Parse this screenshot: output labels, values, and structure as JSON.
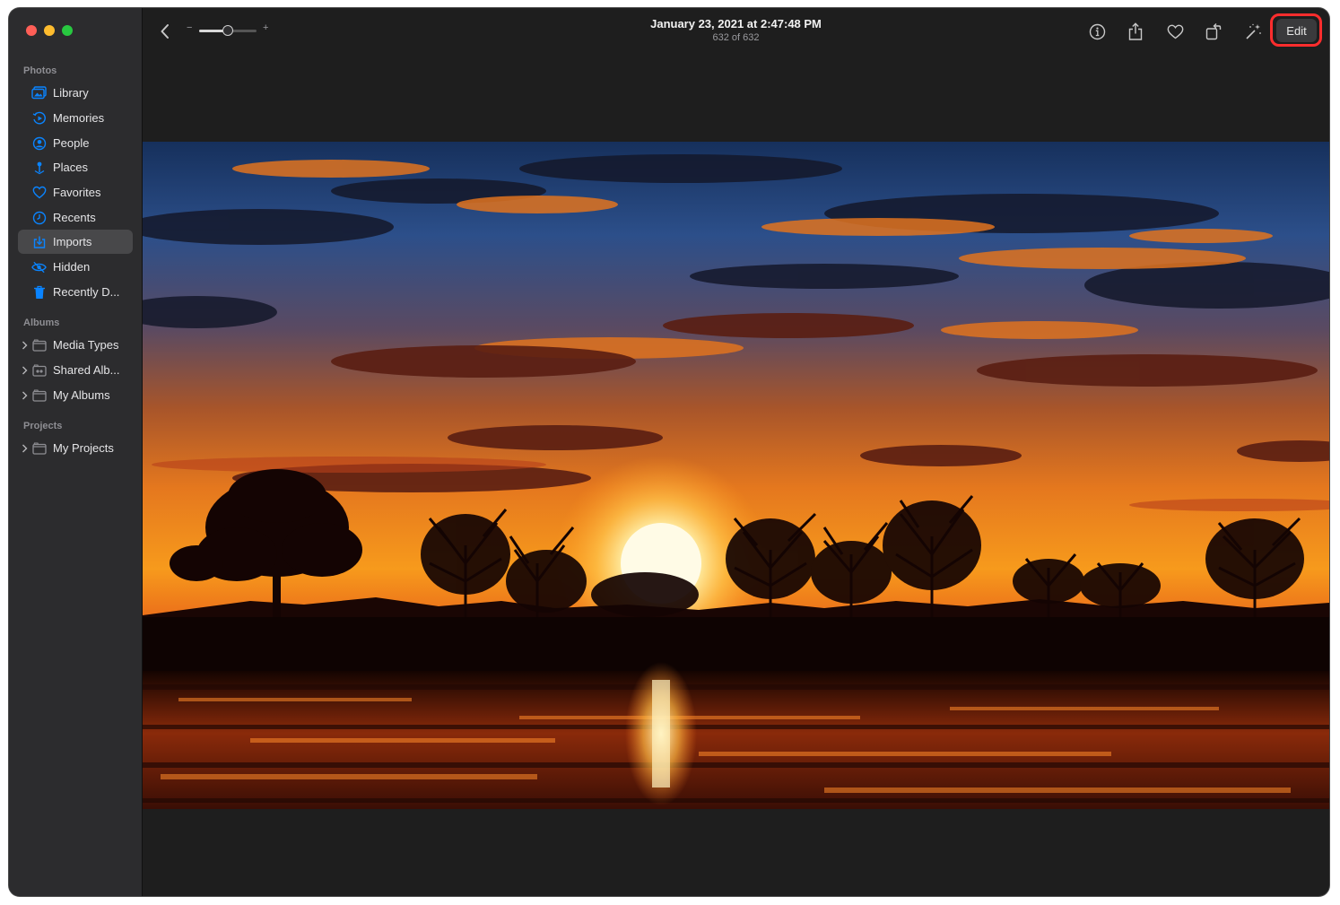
{
  "window": {
    "traffic_lights": [
      "close",
      "minimize",
      "zoom"
    ]
  },
  "sidebar": {
    "sections": {
      "photos": "Photos",
      "albums": "Albums",
      "projects": "Projects"
    },
    "photo_items": [
      {
        "label": "Library",
        "icon": "library-icon"
      },
      {
        "label": "Memories",
        "icon": "memories-icon"
      },
      {
        "label": "People",
        "icon": "people-icon"
      },
      {
        "label": "Places",
        "icon": "places-icon"
      },
      {
        "label": "Favorites",
        "icon": "heart-icon"
      },
      {
        "label": "Recents",
        "icon": "clock-icon"
      },
      {
        "label": "Imports",
        "icon": "import-icon",
        "selected": true
      },
      {
        "label": "Hidden",
        "icon": "eye-slash-icon"
      },
      {
        "label": "Recently D...",
        "icon": "trash-icon"
      }
    ],
    "album_items": [
      {
        "label": "Media Types",
        "icon": "folder-icon"
      },
      {
        "label": "Shared Alb...",
        "icon": "shared-folder-icon"
      },
      {
        "label": "My Albums",
        "icon": "folder-icon"
      }
    ],
    "project_items": [
      {
        "label": "My Projects",
        "icon": "folder-icon"
      }
    ]
  },
  "toolbar": {
    "title": "January 23, 2021 at 2:47:48 PM",
    "subtitle": "632 of 632",
    "zoom_minus": "−",
    "zoom_plus": "+",
    "zoom_level": 0.5,
    "edit_label": "Edit",
    "icons": [
      "info-icon",
      "share-icon",
      "heart-icon",
      "rotate-icon",
      "magic-wand-icon"
    ]
  },
  "colors": {
    "accent": "#0a84ff",
    "highlight": "#ff2d2d",
    "sidebar_bg": "#2c2c2e",
    "content_bg": "#1e1e1e"
  },
  "photo": {
    "subject": "sunset-over-lake"
  }
}
